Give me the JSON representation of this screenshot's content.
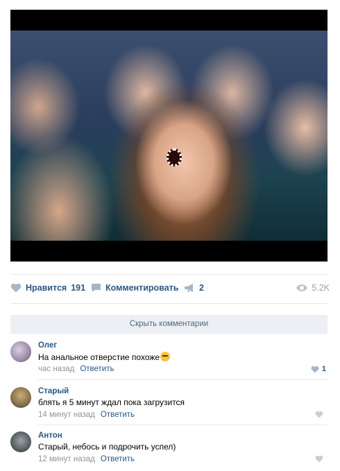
{
  "post": {
    "photo_icon": "crowd-photo"
  },
  "actions": {
    "like_label": "Нравится",
    "like_count": "191",
    "comment_label": "Комментировать",
    "share_count": "2",
    "views": "5.2K"
  },
  "comments_toggle": "Скрыть комментарии",
  "comments": [
    {
      "author": "Олег",
      "text": "На анальное отверстие похоже",
      "time": "час назад",
      "reply": "Ответить",
      "likes": "1",
      "emoji": "grinning-sweat-emoji"
    },
    {
      "author": "Старый",
      "text": "блять я 5 минут ждал пока загрузится",
      "time": "14 минут назад",
      "reply": "Ответить",
      "likes": ""
    },
    {
      "author": "Антон",
      "text": "Старый, небось и подрочить успел)",
      "time": "12 минут назад",
      "reply": "Ответить",
      "likes": ""
    }
  ],
  "colors": {
    "link": "#2a5885",
    "muted": "#939393",
    "bar": "#eceff3"
  }
}
